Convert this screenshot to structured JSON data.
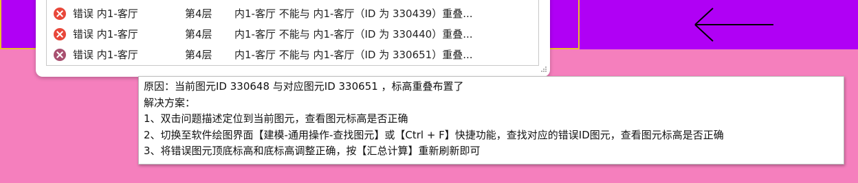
{
  "issues": [
    {
      "type": "错误",
      "location": "内1-客厅",
      "floor": "第4层",
      "description": "内1-客厅 不能与 内1-客厅（ID 为 330439）重叠..."
    },
    {
      "type": "错误",
      "location": "内1-客厅",
      "floor": "第4层",
      "description": "内1-客厅 不能与 内1-客厅（ID 为 330440）重叠..."
    },
    {
      "type": "错误",
      "location": "内1-客厅",
      "floor": "第4层",
      "description": "内1-客厅 不能与 内1-客厅（ID 为 330651）重叠..."
    }
  ],
  "tooltip": {
    "reason": "原因：当前图元ID 330648 与对应图元ID 330651 ，标高重叠布置了",
    "solution_title": "解决方案：",
    "step1": "1、双击问题描述定位到当前图元，查看图元标高是否正确",
    "step2": "2、切换至软件绘图界面【建模-通用操作-查找图元】或【Ctrl + F】快捷功能，查找对应的错误ID图元，查看图元标高是否正确",
    "step3": "3、将错误图元顶底标高和底标高调整正确，按【汇总计算】重新刷新即可"
  },
  "colors": {
    "error_icon": "#e8473a",
    "selected_icon": "#a85070",
    "background_purple": "#b000f5",
    "background_pink": "#f57fbd"
  },
  "icons": [
    "error-icon",
    "back-arrow-icon",
    "resize-grip-icon"
  ]
}
